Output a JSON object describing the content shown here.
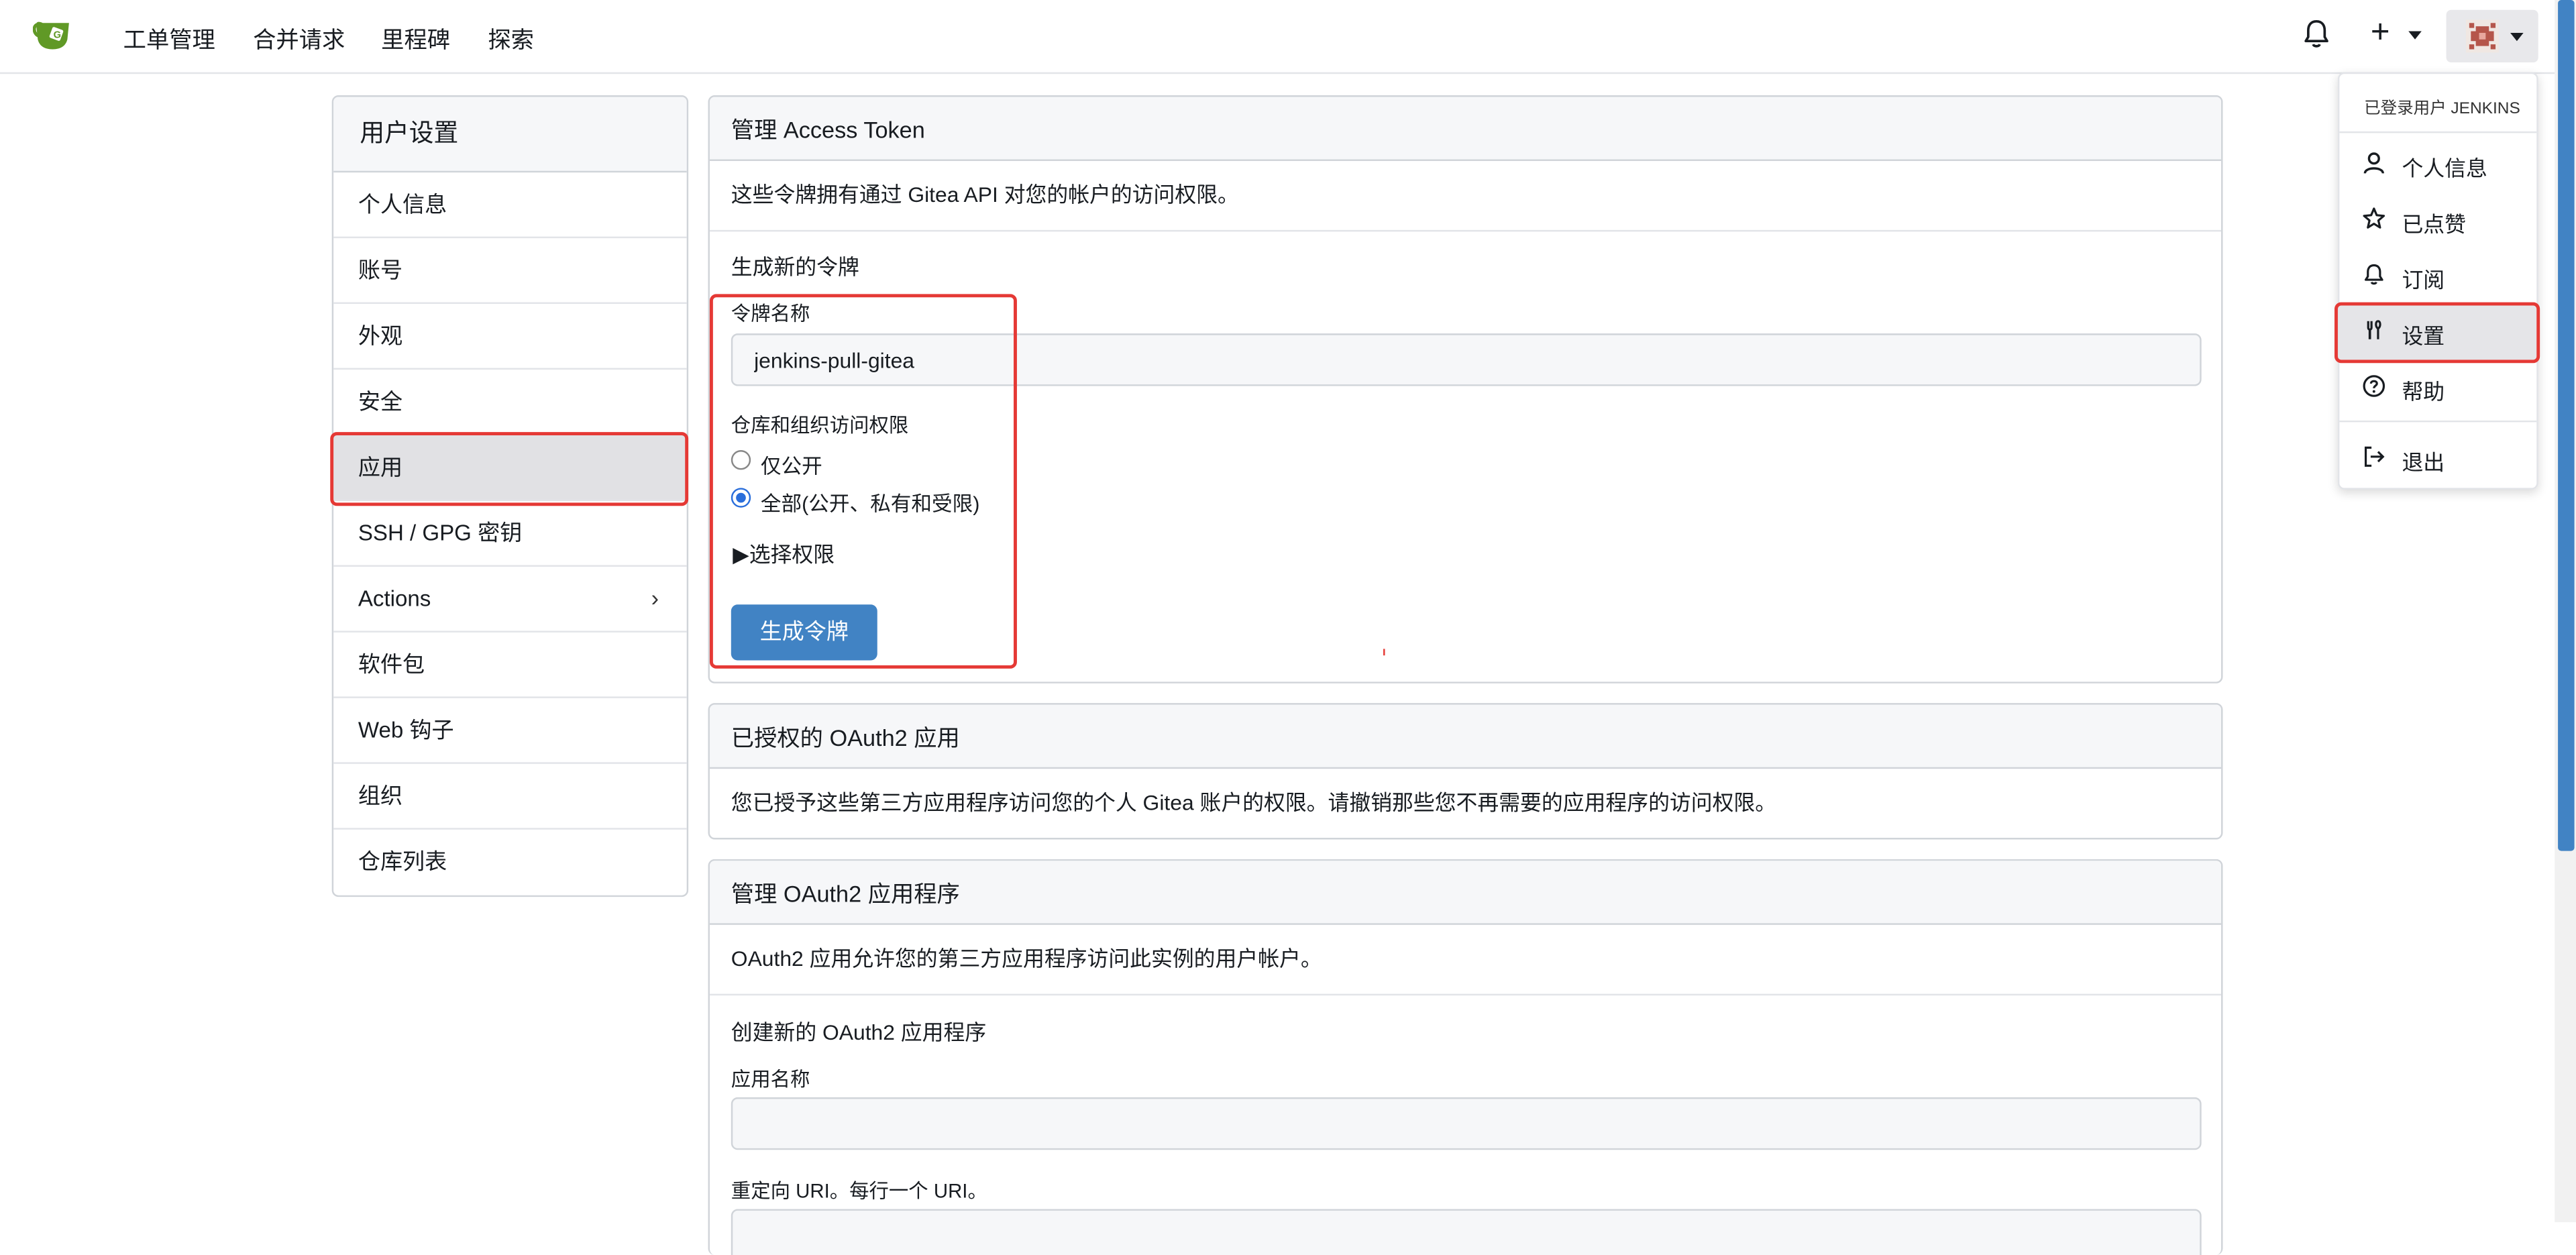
{
  "nav": {
    "items": [
      "工单管理",
      "合并请求",
      "里程碑",
      "探索"
    ]
  },
  "sidebar": {
    "title": "用户设置",
    "items": [
      {
        "label": "个人信息"
      },
      {
        "label": "账号"
      },
      {
        "label": "外观"
      },
      {
        "label": "安全"
      },
      {
        "label": "应用"
      },
      {
        "label": "SSH / GPG 密钥"
      },
      {
        "label": "Actions"
      },
      {
        "label": "软件包"
      },
      {
        "label": "Web 钩子"
      },
      {
        "label": "组织"
      },
      {
        "label": "仓库列表"
      }
    ]
  },
  "token_section": {
    "header": "管理 Access Token",
    "description": "这些令牌拥有通过 Gitea API 对您的帐户的访问权限。",
    "generate_title": "生成新的令牌",
    "name_label": "令牌名称",
    "name_value": "jenkins-pull-gitea",
    "access_label": "仓库和组织访问权限",
    "radio_public": "仅公开",
    "radio_all": "全部(公开、私有和受限)",
    "select_permissions": "▶选择权限",
    "generate_button": "生成令牌"
  },
  "authorized_section": {
    "header": "已授权的 OAuth2 应用",
    "description": "您已授予这些第三方应用程序访问您的个人 Gitea 账户的权限。请撤销那些您不再需要的应用程序的访问权限。"
  },
  "oauth_section": {
    "header": "管理 OAuth2 应用程序",
    "description": "OAuth2 应用允许您的第三方应用程序访问此实例的用户帐户。",
    "create_title": "创建新的 OAuth2 应用程序",
    "app_name_label": "应用名称",
    "redirect_label": "重定向 URI。每行一个 URI。"
  },
  "user_menu": {
    "signed_in_as": "已登录用户 JENKINS",
    "items": [
      {
        "label": "个人信息",
        "icon": "person-icon"
      },
      {
        "label": "已点赞",
        "icon": "star-icon"
      },
      {
        "label": "订阅",
        "icon": "bell-icon"
      },
      {
        "label": "设置",
        "icon": "tools-icon"
      },
      {
        "label": "帮助",
        "icon": "question-icon"
      },
      {
        "label": "退出",
        "icon": "sign-out-icon"
      }
    ]
  },
  "colors": {
    "primary": "#4183c4",
    "highlight": "#e53935",
    "logo": "#609926"
  }
}
